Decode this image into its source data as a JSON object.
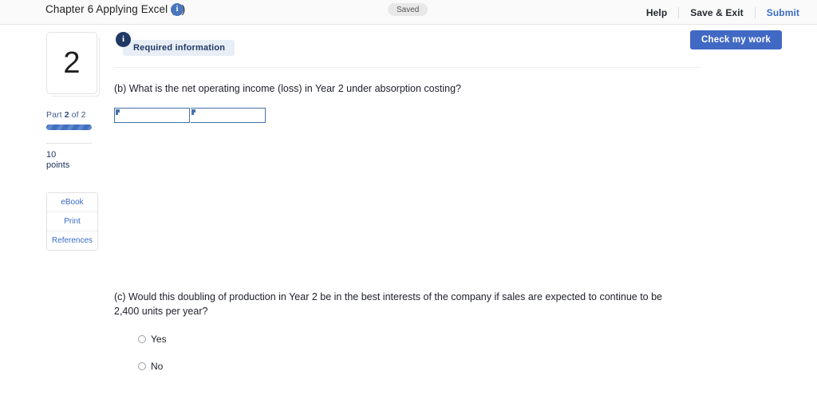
{
  "header": {
    "title": "Chapter 6 Applying Excel (A)",
    "info_icon": "info-icon",
    "info_glyph": "i",
    "status_badge": "Saved",
    "help_label": "Help",
    "save_exit_label": "Save & Exit",
    "submit_label": "Submit"
  },
  "toolbar": {
    "check_my_work_label": "Check my work"
  },
  "sidebar": {
    "question_number": "2",
    "part_prefix": "Part ",
    "part_current": "2",
    "part_suffix": " of 2",
    "progress_percent": 100,
    "points_value": "10",
    "points_label": "points",
    "buttons": [
      {
        "label": "eBook",
        "name": "ebook-button"
      },
      {
        "label": "Print",
        "name": "print-button"
      },
      {
        "label": "References",
        "name": "references-button"
      }
    ]
  },
  "main": {
    "required_info_glyph": "i",
    "required_info_label": "Required information",
    "question_b": "(b) What is the net operating income (loss) in Year 2 under absorption costing?",
    "answer_cells": [
      {
        "value": "",
        "placeholder": ""
      },
      {
        "value": "",
        "placeholder": ""
      }
    ],
    "question_c": "(c) Would this doubling of production in Year 2 be in the best interests of the company if sales are expected to continue to be 2,400 units per year?",
    "radio_options": [
      {
        "label": "Yes",
        "selected": false
      },
      {
        "label": "No",
        "selected": false
      }
    ]
  },
  "colors": {
    "accent_blue": "#4169c4",
    "link_blue": "#3a6bc4",
    "badge_navy": "#1f3864",
    "cell_border": "#4472a8",
    "header_bg": "#fafafa"
  }
}
